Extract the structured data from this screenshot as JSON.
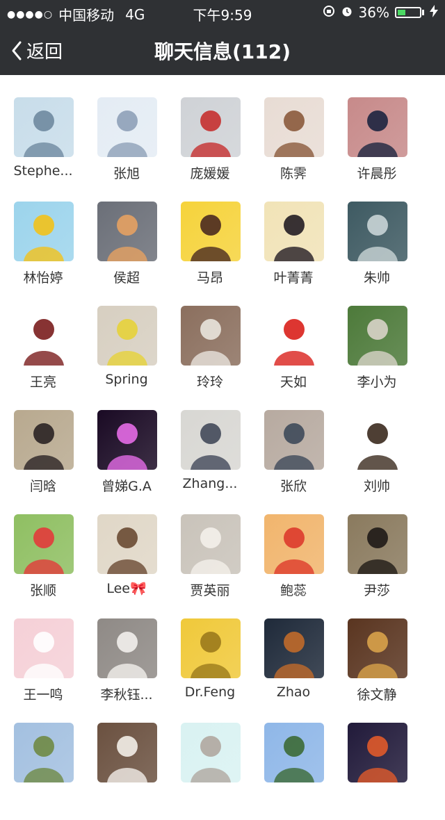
{
  "status_bar": {
    "carrier": "中国移动",
    "network": "4G",
    "time": "下午9:59",
    "battery": "36%",
    "battery_level": 0.36
  },
  "nav": {
    "back_label": "返回",
    "title": "聊天信息(112)"
  },
  "members": [
    {
      "name": "Stephe...",
      "colors": [
        "#c8ddea",
        "#6f8aa0"
      ],
      "icon": "person-photo-avatar"
    },
    {
      "name": "张旭",
      "colors": [
        "#e4ecf4",
        "#8ea0b8"
      ],
      "icon": "anime-girl-avatar"
    },
    {
      "name": "庞媛媛",
      "colors": [
        "#cfd2d6",
        "#c5302f"
      ],
      "icon": "person-photo-avatar"
    },
    {
      "name": "陈霁",
      "colors": [
        "#e8dcd4",
        "#8b5a3c"
      ],
      "icon": "wedding-photo-avatar"
    },
    {
      "name": "许晨彤",
      "colors": [
        "#c78a8a",
        "#1d2540"
      ],
      "icon": "person-photo-avatar"
    },
    {
      "name": "林怡婷",
      "colors": [
        "#9cd4ec",
        "#f2c21a"
      ],
      "icon": "sunflower-avatar"
    },
    {
      "name": "侯超",
      "colors": [
        "#6b6f78",
        "#e6a162"
      ],
      "icon": "silhouette-avatar"
    },
    {
      "name": "马昂",
      "colors": [
        "#f6d33b",
        "#4a2a20"
      ],
      "icon": "cartoon-girl-avatar"
    },
    {
      "name": "叶菁菁",
      "colors": [
        "#f1e3b7",
        "#231d24"
      ],
      "icon": "piano-avatar"
    },
    {
      "name": "朱帅",
      "colors": [
        "#3e5a62",
        "#c9d4d6"
      ],
      "icon": "scene-photo-avatar"
    },
    {
      "name": "王亮",
      "colors": [
        "#ffffff",
        "#7a1d1d"
      ],
      "icon": "anime-character-avatar"
    },
    {
      "name": "Spring",
      "colors": [
        "#d7cfc1",
        "#e6d23a"
      ],
      "icon": "person-photo-avatar"
    },
    {
      "name": "玲玲",
      "colors": [
        "#8b6f5e",
        "#e9e4dd"
      ],
      "icon": "cat-avatar"
    },
    {
      "name": "天如",
      "colors": [
        "#ffffff",
        "#d9201b"
      ],
      "icon": "witch-cartoon-avatar"
    },
    {
      "name": "李小为",
      "colors": [
        "#4d7a3a",
        "#d8d3c8"
      ],
      "icon": "scene-photo-avatar"
    },
    {
      "name": "闫晗",
      "colors": [
        "#b8a98f",
        "#2a2324"
      ],
      "icon": "person-photo-avatar"
    },
    {
      "name": "曾娣G.A",
      "colors": [
        "#1a0a24",
        "#e46be6"
      ],
      "icon": "moon-silhouette-avatar"
    },
    {
      "name": "Zhang...",
      "colors": [
        "#d8d7d3",
        "#42495a"
      ],
      "icon": "person-photo-avatar"
    },
    {
      "name": "张欣",
      "colors": [
        "#b7aaa0",
        "#3e4a5a"
      ],
      "icon": "person-photo-avatar"
    },
    {
      "name": "刘帅",
      "colors": [
        "#ffffff",
        "#3b2a1e"
      ],
      "icon": "cartoon-boy-avatar"
    },
    {
      "name": "张顺",
      "colors": [
        "#8fbf62",
        "#e23b3b"
      ],
      "icon": "child-santa-hat-avatar"
    },
    {
      "name": "Lee🎀",
      "colors": [
        "#e0d7c7",
        "#6a4a33"
      ],
      "icon": "bookshelf-avatar"
    },
    {
      "name": "贾英丽",
      "colors": [
        "#c9c3ba",
        "#f4f0ea"
      ],
      "icon": "bride-photo-avatar"
    },
    {
      "name": "鲍蕊",
      "colors": [
        "#f1b56d",
        "#dd3b2c"
      ],
      "icon": "cartoon-santa-hat-avatar"
    },
    {
      "name": "尹莎",
      "colors": [
        "#8a7a5e",
        "#1f1a17"
      ],
      "icon": "dog-avatar"
    },
    {
      "name": "王一鸣",
      "colors": [
        "#f5d0d7",
        "#ffffff"
      ],
      "icon": "cartoon-dog-avatar"
    },
    {
      "name": "李秋钰...",
      "colors": [
        "#8f8a86",
        "#f2f0ec"
      ],
      "icon": "bride-photo-avatar"
    },
    {
      "name": "Dr.Feng",
      "colors": [
        "#f0c93a",
        "#9b7a1c"
      ],
      "icon": "little-prince-avatar"
    },
    {
      "name": "Zhao",
      "colors": [
        "#1f2a3a",
        "#c06a2a"
      ],
      "icon": "night-scene-avatar"
    },
    {
      "name": "徐文静",
      "colors": [
        "#5a3520",
        "#d8a24a"
      ],
      "icon": "masquerade-avatar"
    },
    {
      "name": "",
      "colors": [
        "#a3c0e0",
        "#6f8a45"
      ],
      "icon": "grassland-photo-avatar"
    },
    {
      "name": "",
      "colors": [
        "#6b5140",
        "#f3eee8"
      ],
      "icon": "puppy-avatar"
    },
    {
      "name": "",
      "colors": [
        "#d9f2f2",
        "#b0a7a0"
      ],
      "icon": "cartoon-cat-avatar"
    },
    {
      "name": "",
      "colors": [
        "#8fb7e8",
        "#3c6a36"
      ],
      "icon": "lake-scene-avatar"
    },
    {
      "name": "",
      "colors": [
        "#211a3a",
        "#e05a2a"
      ],
      "icon": "night-street-avatar"
    }
  ]
}
